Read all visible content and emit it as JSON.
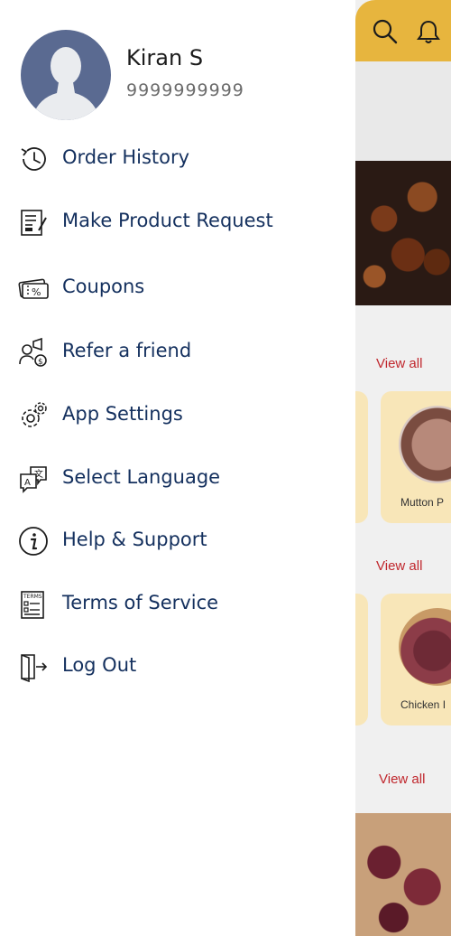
{
  "user": {
    "name": "Kiran S",
    "phone": "9999999999"
  },
  "menu": [
    {
      "label": "Order History",
      "icon": "history-icon"
    },
    {
      "label": "Make Product Request",
      "icon": "request-form-icon"
    },
    {
      "label": "Coupons",
      "icon": "coupon-icon"
    },
    {
      "label": "Refer a friend",
      "icon": "refer-friend-icon"
    },
    {
      "label": "App Settings",
      "icon": "gear-icon"
    },
    {
      "label": "Select Language",
      "icon": "language-icon"
    },
    {
      "label": "Help & Support",
      "icon": "info-icon"
    },
    {
      "label": "Terms of Service",
      "icon": "terms-document-icon"
    },
    {
      "label": "Log Out",
      "icon": "logout-icon"
    }
  ],
  "background": {
    "view_all_1": "View all",
    "view_all_2": "View all",
    "view_all_3": "View all",
    "card_1_label": "Mutton P",
    "card_2_label": "Chicken I"
  },
  "colors": {
    "menu_text": "#14305e",
    "header_accent": "#e7b53e",
    "view_all": "#c0272d",
    "card_bg": "#f8e6b8",
    "avatar_bg": "#5a6a91"
  }
}
